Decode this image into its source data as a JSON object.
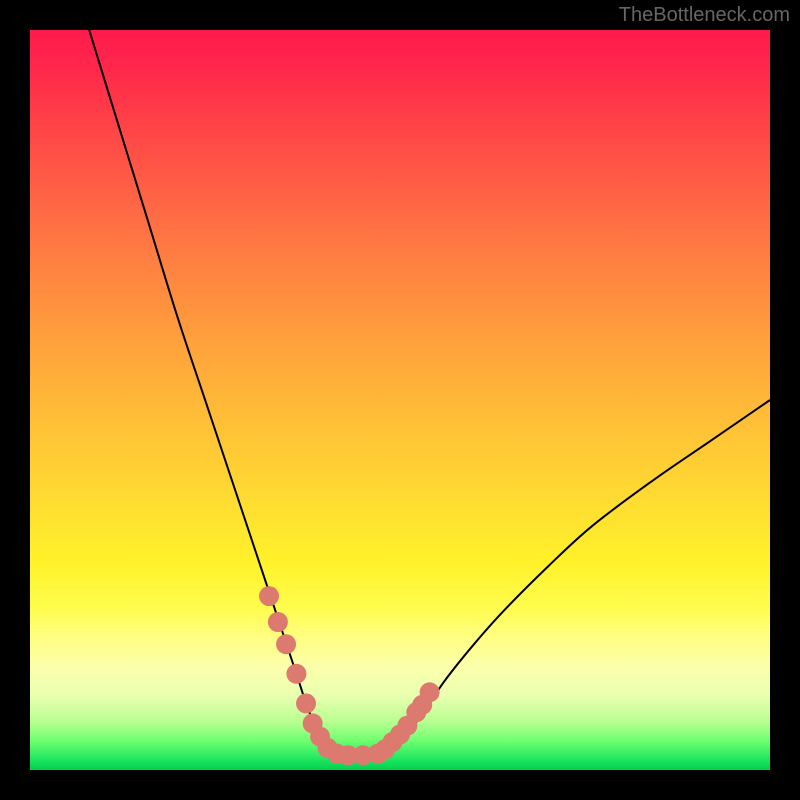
{
  "watermark": "TheBottleneck.com",
  "chart_data": {
    "type": "line",
    "title": "",
    "xlabel": "",
    "ylabel": "",
    "xlim": [
      0,
      100
    ],
    "ylim": [
      0,
      100
    ],
    "background_gradient": {
      "top": "#ff1a4d",
      "mid": "#fff22a",
      "bottom": "#00d050"
    },
    "series": [
      {
        "name": "bottleneck-curve",
        "color": "#000000",
        "x": [
          8,
          12,
          16,
          20,
          24,
          28,
          32,
          34,
          36,
          37.5,
          39,
          40.5,
          42,
          43,
          46,
          48,
          50,
          53,
          56,
          60,
          64,
          70,
          76,
          84,
          92,
          100
        ],
        "y": [
          100,
          87,
          74,
          61,
          49,
          37,
          25,
          19,
          13,
          8.5,
          5,
          2.8,
          2,
          2,
          2,
          2.5,
          4,
          7.5,
          12,
          17,
          21.5,
          27.5,
          33,
          39,
          44.5,
          50
        ]
      }
    ],
    "markers": [
      {
        "name": "highlight-dots",
        "color": "#dd7a70",
        "x": [
          32.3,
          33.5,
          34.6,
          36.0,
          37.3,
          38.2,
          39.2,
          40.2,
          41.5,
          43.0,
          45.0,
          47.0,
          48.0,
          49.0,
          50.0,
          51.0,
          52.2,
          53.0,
          54.0
        ],
        "y": [
          23.5,
          20.0,
          17.0,
          13.0,
          9.0,
          6.3,
          4.5,
          3.0,
          2.2,
          2.0,
          2.0,
          2.2,
          2.8,
          3.8,
          4.8,
          6.0,
          7.8,
          8.8,
          10.5
        ]
      }
    ]
  }
}
